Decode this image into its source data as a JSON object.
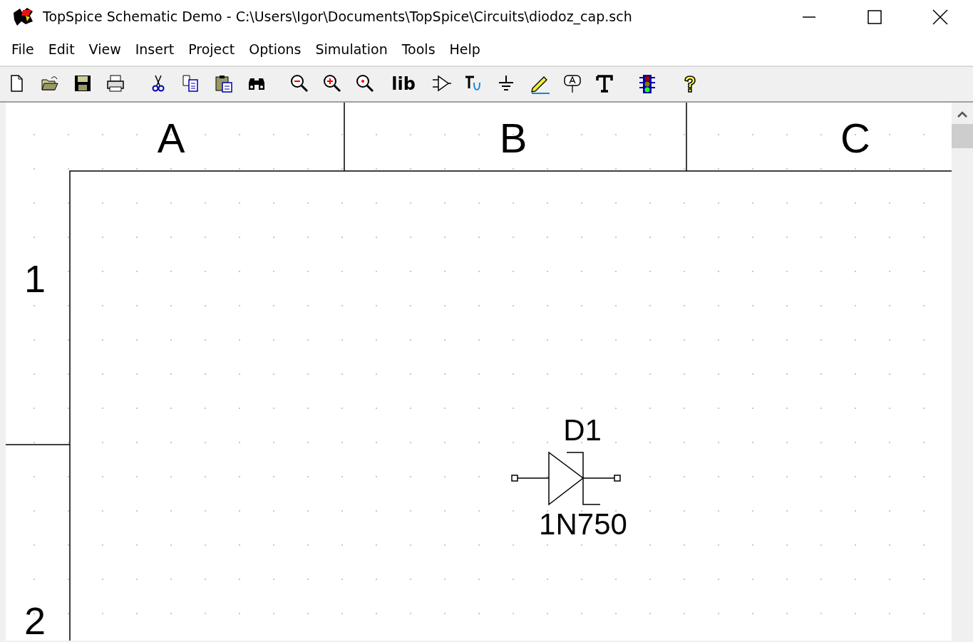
{
  "window": {
    "title": "TopSpice Schematic Demo - C:\\Users\\Igor\\Documents\\TopSpice\\Circuits\\diodoz_cap.sch"
  },
  "menu": [
    "File",
    "Edit",
    "View",
    "Insert",
    "Project",
    "Options",
    "Simulation",
    "Tools",
    "Help"
  ],
  "toolbar": {
    "library_button_label": "lib"
  },
  "schematic": {
    "columns": [
      "A",
      "B",
      "C"
    ],
    "rows": [
      "1",
      "2"
    ],
    "component": {
      "kind": "zener-diode",
      "reference": "D1",
      "value": "1N750"
    }
  }
}
